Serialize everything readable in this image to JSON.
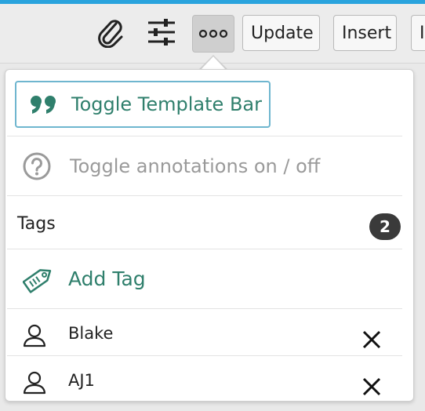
{
  "toolbar": {
    "attach_icon": "paperclip-icon",
    "settings_icon": "sliders-icon",
    "more_icon": "more-dots-icon",
    "update_label": "Update",
    "insert_label": "Insert",
    "cut_label": "I"
  },
  "menu": {
    "template_bar_label": "Toggle Template Bar",
    "template_bar_icon": "quote-icon",
    "annotations_label": "Toggle annotations on / off",
    "annotations_icon": "help-circle-icon",
    "tags_label": "Tags",
    "tags_count": "2",
    "add_tag_label": "Add Tag",
    "add_tag_icon": "tag-icon",
    "tags": [
      {
        "name": "Blake",
        "icon": "user-icon",
        "remove_icon": "close-icon"
      },
      {
        "name": "AJ1",
        "icon": "user-icon",
        "remove_icon": "close-icon"
      }
    ]
  },
  "colors": {
    "accent": "#2f7f6c",
    "focus_border": "#6fb6cf",
    "top_bar": "#29a3dd",
    "muted": "#9a9a9a",
    "badge": "#3a3a3a"
  }
}
